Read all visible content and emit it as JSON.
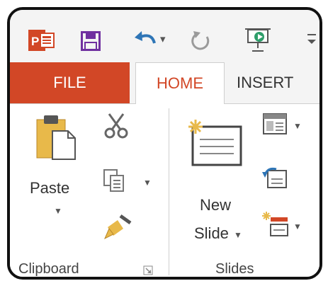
{
  "tabs": {
    "file": "FILE",
    "home": "HOME",
    "insert": "INSERT"
  },
  "quick_access": {
    "app_logo_text": "P",
    "icons": [
      "powerpoint-logo-icon",
      "save-icon",
      "undo-icon",
      "redo-icon",
      "start-slideshow-icon",
      "customize-toolbar-icon"
    ]
  },
  "clipboard": {
    "paste_label": "Paste",
    "group_label": "Clipboard"
  },
  "slides": {
    "new_slide_line1": "New",
    "new_slide_line2": "Slide",
    "group_label": "Slides"
  },
  "colors": {
    "file_tab": "#d24726",
    "home_text": "#d24726",
    "save_icon": "#7030a0",
    "undo_icon": "#2e75b6",
    "clipboard_yellow": "#e8b94a"
  }
}
